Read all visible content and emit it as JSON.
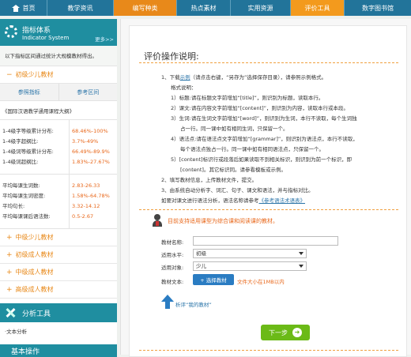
{
  "nav": {
    "items": [
      "首页",
      "教学资讯",
      "编写种类",
      "热点素材",
      "实用资源",
      "评价工具",
      "数字图书馆"
    ],
    "active_index": 5
  },
  "sidebar": {
    "title": "指标体系",
    "title_en": "Indicator System",
    "more": "更多>>",
    "description": "以下指标区间通过统计大规模教材得出。",
    "level1": "初级少儿教材",
    "col_indicator": "参照指标",
    "col_range": "参考区间",
    "corpus": "《国际汉语教学通用课程大纲》",
    "group1": {
      "labels": [
        "1-4级字等级累计分布:",
        "1-4级字超纲比:",
        "1-4级词等级累计分布:",
        "1-4级词超纲比:"
      ],
      "values": [
        "68.46%-100%",
        "3.7%-49%",
        "66.49%-89.9%",
        "1.83%-27.67%"
      ]
    },
    "group2": {
      "labels": [
        "平均每课生词数:",
        "平均每课生词密度:",
        "平均句长:",
        "平均每课课后语法数:"
      ],
      "values": [
        "2.83-26.33",
        "1.58%-64.78%",
        "3.32-14.12",
        "0.5-2.67"
      ]
    },
    "other_levels": [
      "中级少儿教材",
      "初级成人教材",
      "中级成人教材",
      "高级成人教材"
    ],
    "tools_title": "分析工具",
    "tools_item": "·文本分析",
    "tools2_title": "基本操作"
  },
  "main": {
    "heading": "评价操作说明:",
    "step1": {
      "prefix": "1、下载",
      "link": "示例",
      "suffix": "（请点击右键，“另存为”选择保存目录），请参照示例格式。"
    },
    "format_title": "格式说明：",
    "rules": [
      "1）标题:请在标题文字前增加“[title]”，则识别为标题，读取本行。",
      "2）课文:请在内容文字前增加“[content]”，则识别为内容，读取本行或本段。",
      "3）生词:请在生词文字前增加“[word]”，则识别为生词，本行不读取，每个生词独"
    ],
    "rule3_cont": "占一行。同一课中如有相同生词，只保留一个。",
    "rule4": "4）语法点:请在语法点文字前增加“[grammar]”，则识别为语法点，本行不读取，",
    "rule4_cont": "每个语法点独占一行。同一课中如有相同语法点，只保留一个。",
    "rule5": "5）[content]标识行或段落后如果读取不到相关标识，则识别为前一个标识，即",
    "rule5_cont": "[content]。其它标识同。请参看模板或示例。",
    "step2": "2、填写教材信息，上传教材文件，提交。",
    "step3": "3、由系统自动分析字、词汇、句子、课文和语法，并与指标对比。",
    "note_prefix": "如要对课文进行语法分析，语法名称请参考",
    "note_link": "《参考语法术语表》",
    "support_text": "目前支持适用课型为综合课和阅读课的教材。",
    "form": {
      "name_label": "教材名称:",
      "name_value": "",
      "level_label": "适用水平:",
      "level_value": "初级",
      "target_label": "适用对象:",
      "target_value": "少儿",
      "file_label": "教材文本:",
      "file_button": "+ 选择教材",
      "file_hint": "文件大小在1MB以内"
    },
    "analyze_link": "析评“我的教材”",
    "next_button": "下一步"
  }
}
